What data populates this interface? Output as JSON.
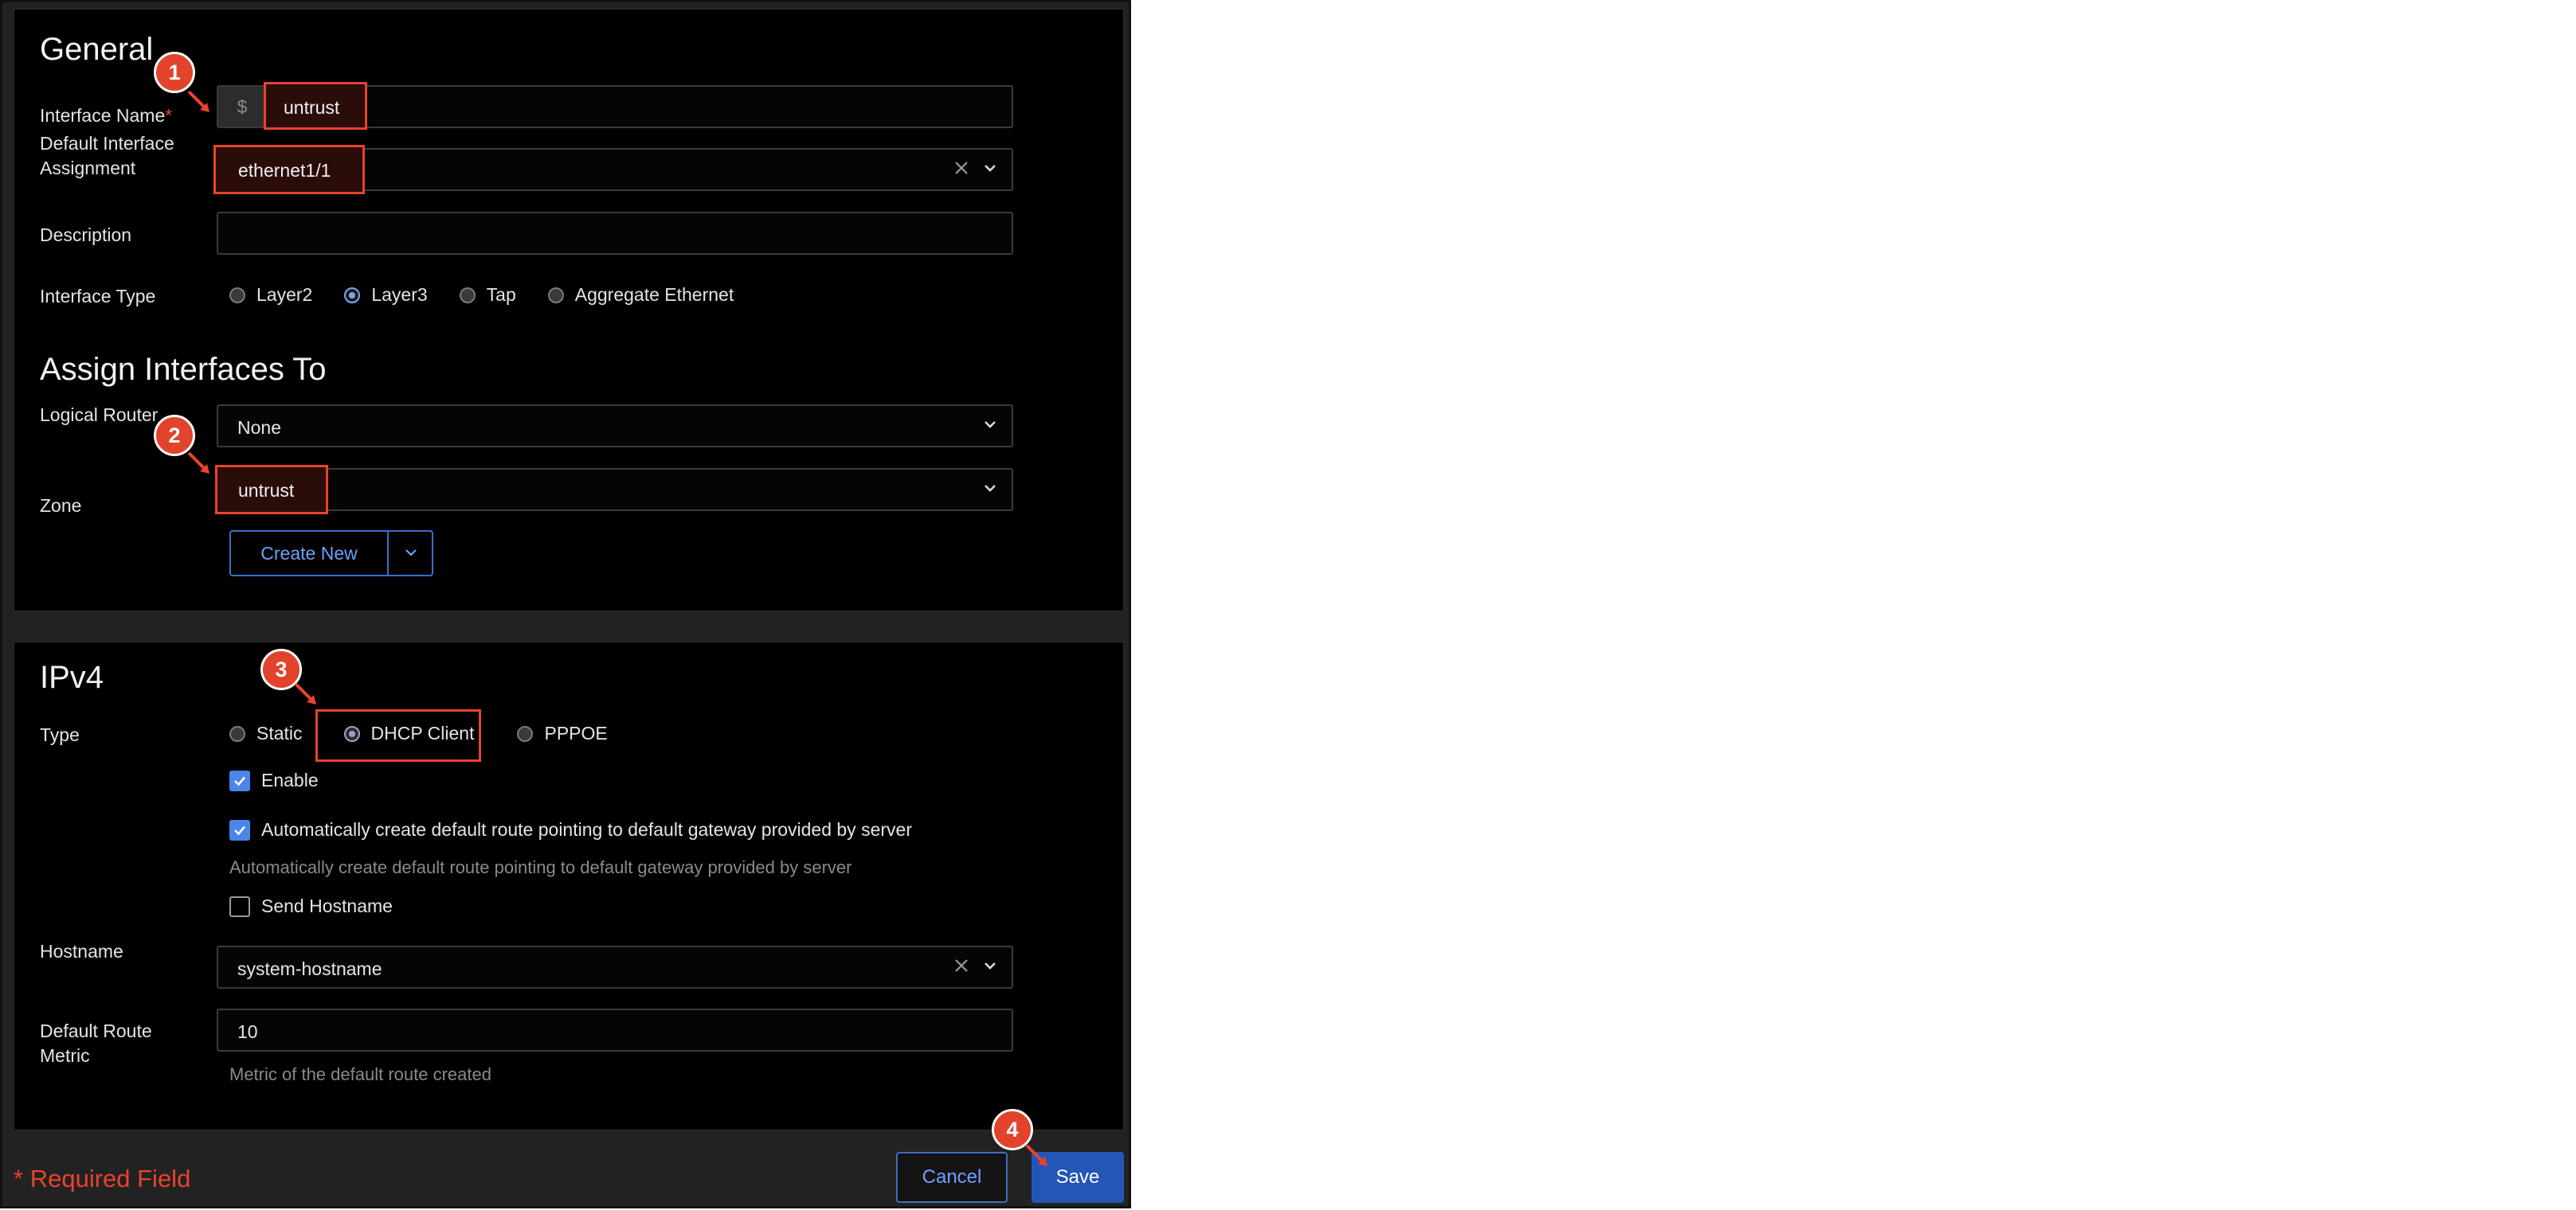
{
  "general": {
    "title": "General",
    "interface_name_label": "Interface Name",
    "required_mark": "*",
    "prefix": "$",
    "interface_name_value": "untrust",
    "default_assignment_label_1": "Default Interface",
    "default_assignment_label_2": "Assignment",
    "default_assignment_value": "ethernet1/1",
    "description_label": "Description",
    "description_value": "",
    "interface_type_label": "Interface Type",
    "interface_types": [
      "Layer2",
      "Layer3",
      "Tap",
      "Aggregate Ethernet"
    ],
    "interface_type_selected": "Layer3"
  },
  "assign": {
    "title": "Assign Interfaces To",
    "logical_router_label": "Logical Router",
    "logical_router_value": "None",
    "zone_label": "Zone",
    "zone_value": "untrust",
    "create_new_label": "Create New"
  },
  "ipv4": {
    "title": "IPv4",
    "type_label": "Type",
    "types": [
      "Static",
      "DHCP Client",
      "PPPOE"
    ],
    "type_selected": "DHCP Client",
    "enable_label": "Enable",
    "enable_checked": true,
    "auto_route_label": "Automatically create default route pointing to default gateway provided by server",
    "auto_route_checked": true,
    "auto_route_help": "Automatically create default route pointing to default gateway provided by server",
    "send_hostname_label": "Send Hostname",
    "send_hostname_checked": false,
    "hostname_label": "Hostname",
    "hostname_value": "system-hostname",
    "metric_label_1": "Default Route",
    "metric_label_2": "Metric",
    "metric_value": "10",
    "metric_help": "Metric of the default route created"
  },
  "footer": {
    "required_text": "Required Field",
    "required_mark": "*",
    "cancel_label": "Cancel",
    "save_label": "Save"
  },
  "annotations": [
    "1",
    "2",
    "3",
    "4"
  ],
  "colors": {
    "accent": "#4a86e8",
    "highlight": "#e8432d",
    "save_bg": "#2456b8"
  }
}
